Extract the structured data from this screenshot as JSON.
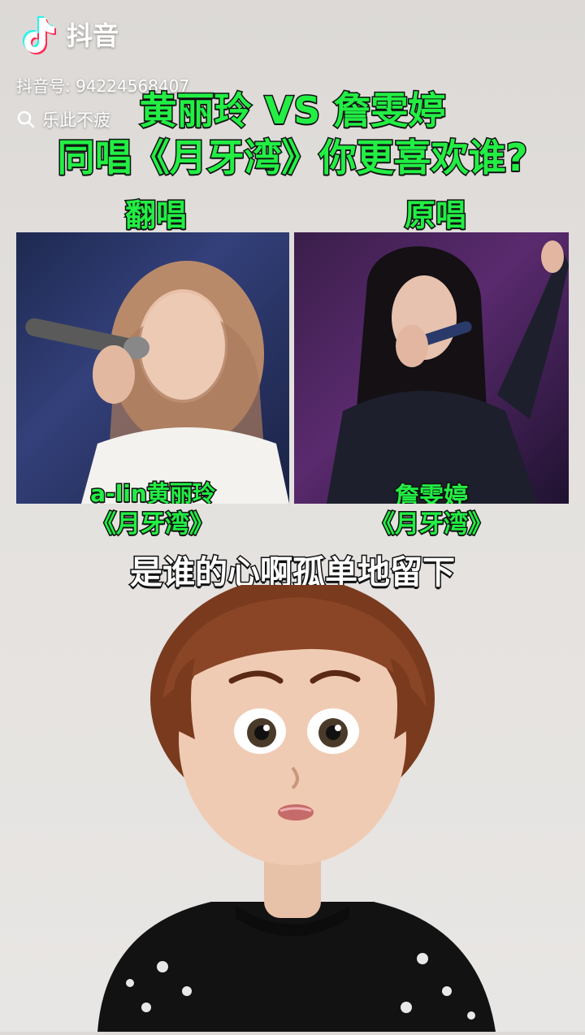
{
  "app": {
    "brand": "抖音",
    "account_id": "抖音号: 94224568407"
  },
  "search": {
    "keyword": "乐此不疲",
    "icon": "search-icon"
  },
  "headline": {
    "line1": "黄丽玲 VS 詹雯婷",
    "line2": "同唱《月牙湾》你更喜欢谁?"
  },
  "left": {
    "label": "翻唱",
    "caption_line1": "a-lin黄丽玲",
    "caption_line2": "《月牙湾》"
  },
  "right": {
    "label": "原唱",
    "caption_line1": "詹雯婷",
    "caption_line2": "《月牙湾》"
  },
  "lyrics": "是谁的心啊孤单地留下",
  "colors": {
    "accent": "#22ee44",
    "stroke": "#111111"
  }
}
